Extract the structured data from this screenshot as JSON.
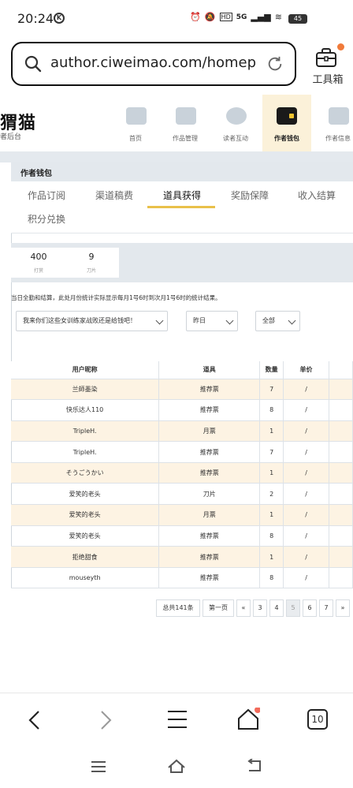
{
  "status_bar": {
    "time": "20:24",
    "k_badge": "K",
    "network": "5G",
    "battery": "45"
  },
  "browser": {
    "url": "author.ciweimao.com/homepa…",
    "toolbox_label": "工具箱"
  },
  "site": {
    "logo": "猬猫",
    "logo_sub": "者后台",
    "nav": [
      {
        "label": "首页",
        "icon": "home-icon"
      },
      {
        "label": "作品管理",
        "icon": "book-icon"
      },
      {
        "label": "读者互动",
        "icon": "paw-icon"
      },
      {
        "label": "作者钱包",
        "icon": "wallet-icon"
      },
      {
        "label": "作者信息",
        "icon": "id-card-icon"
      }
    ]
  },
  "wallet": {
    "title": "作者钱包",
    "tabs": [
      "作品订阅",
      "渠道稿费",
      "道具获得",
      "奖励保障",
      "收入结算",
      "积分兑换"
    ],
    "active_tab": "道具获得",
    "stats": [
      {
        "value": "400",
        "label": "打赏"
      },
      {
        "value": "9",
        "label": "刀片"
      }
    ],
    "notice": "当日全勤和结算，此处月份统计实际显示每月1号6时到次月1号6时的统计结果。",
    "filters": {
      "book": "我来你们这些女训练家战败还是给钱吧！",
      "date": "昨日",
      "type": "全部"
    },
    "table": {
      "headers": [
        "用户昵称",
        "道具",
        "数量",
        "单价"
      ],
      "rows": [
        [
          "兰師墨染",
          "推荐票",
          "7",
          "/"
        ],
        [
          "快乐达人110",
          "推荐票",
          "8",
          "/"
        ],
        [
          "TripleH.",
          "月票",
          "1",
          "/"
        ],
        [
          "TripleH.",
          "推荐票",
          "7",
          "/"
        ],
        [
          "そうごうかい",
          "推荐票",
          "1",
          "/"
        ],
        [
          "爱笑的老头",
          "刀片",
          "2",
          "/"
        ],
        [
          "爱笑的老头",
          "月票",
          "1",
          "/"
        ],
        [
          "爱笑的老头",
          "推荐票",
          "8",
          "/"
        ],
        [
          "拒绝甜食",
          "推荐票",
          "1",
          "/"
        ],
        [
          "mouseyth",
          "推荐票",
          "8",
          "/"
        ]
      ]
    },
    "pagination": {
      "total": "总共141条",
      "first": "第一页",
      "prev": "«",
      "pages": [
        "3",
        "4",
        "5",
        "6",
        "7"
      ],
      "current": "5",
      "next": "»"
    }
  },
  "bottom_nav": {
    "tab_count": "10"
  }
}
